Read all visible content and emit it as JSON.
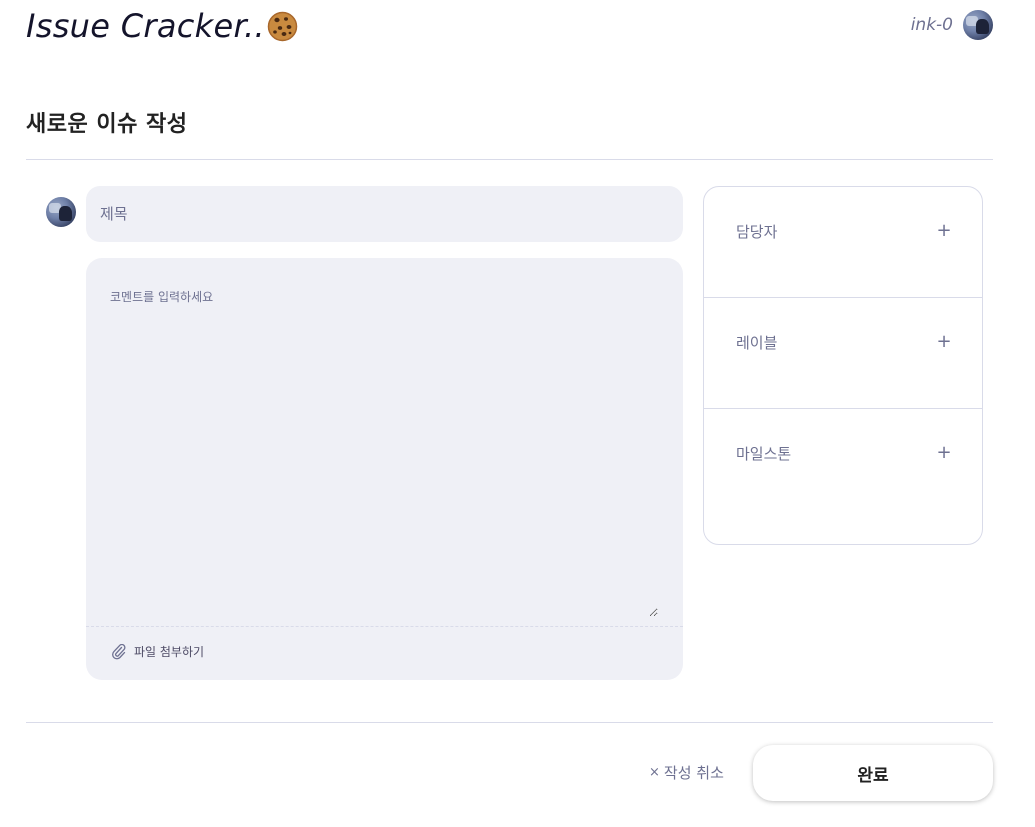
{
  "header": {
    "brand": "Issue Cracker..",
    "username": "ink-0",
    "icons": {
      "logo": "cookie-icon",
      "avatar": "user-avatar"
    }
  },
  "page": {
    "title": "새로운 이슈 작성"
  },
  "form": {
    "title_placeholder": "제목",
    "title_value": "",
    "comment_placeholder": "코멘트를 입력하세요",
    "comment_value": "",
    "attach_label": "파일 첨부하기",
    "attach_icon": "paperclip-icon"
  },
  "sidebar": {
    "sections": [
      {
        "label": "담당자",
        "action": "+"
      },
      {
        "label": "레이블",
        "action": "+"
      },
      {
        "label": "마일스톤",
        "action": "+"
      }
    ]
  },
  "actions": {
    "cancel_icon": "×",
    "cancel_label": "작성 취소",
    "done_label": "완료"
  },
  "colors": {
    "input_bg": "#eff0f6",
    "border": "#d9dbe9",
    "label": "#6e7191",
    "title_text": "#14142b"
  }
}
